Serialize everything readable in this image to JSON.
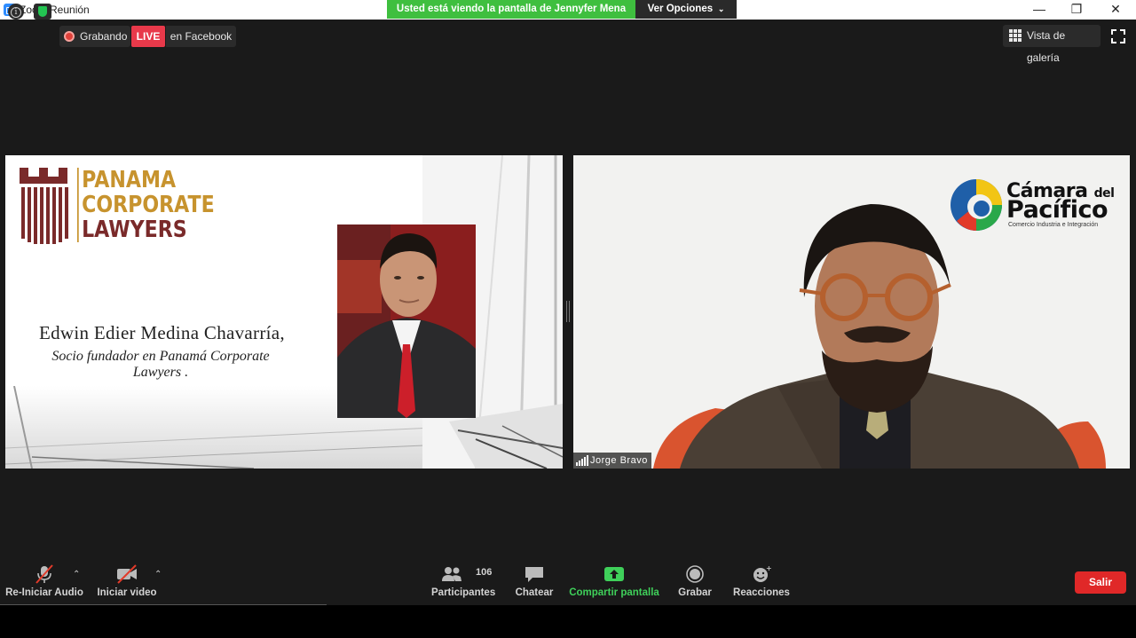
{
  "window": {
    "title": "Zoom Reunión",
    "share_banner": "Usted está viendo la pantalla de Jennyfer Mena",
    "view_options": "Ver Opciones",
    "controls": {
      "minimize": "—",
      "restore": "❐",
      "close": "✕"
    }
  },
  "topbar": {
    "recording_label": "Grabando",
    "live_badge": "LIVE",
    "live_target": "en Facebook",
    "gallery_view_label": "Vista de galería"
  },
  "shared_slide": {
    "logo_lines": [
      "PANAMA",
      "CORPORATE",
      "LAWYERS"
    ],
    "speaker_name": "Edwin Edier Medina Chavarría,",
    "speaker_role": "Socio fundador en Panamá Corporate Lawyers ."
  },
  "video_tile": {
    "logo_line1": "Cámara",
    "logo_line1_small": "del",
    "logo_line2": "Pacífico",
    "logo_line3": "Comercio Industria e Integración",
    "participant_name": "Jorge Bravo"
  },
  "toolbar": {
    "audio_label": "Re-Iniciar Audio",
    "video_label": "Iniciar video",
    "participants_label": "Participantes",
    "participants_count": "106",
    "chat_label": "Chatear",
    "share_label": "Compartir pantalla",
    "record_label": "Grabar",
    "reactions_label": "Reacciones",
    "leave_label": "Salir"
  },
  "colors": {
    "share_banner": "#3fbf3f",
    "live": "#e8394a",
    "share_accent": "#3fd05a",
    "leave": "#e02828",
    "pcl_gold": "#c7932e",
    "pcl_maroon": "#7a2a2a"
  }
}
